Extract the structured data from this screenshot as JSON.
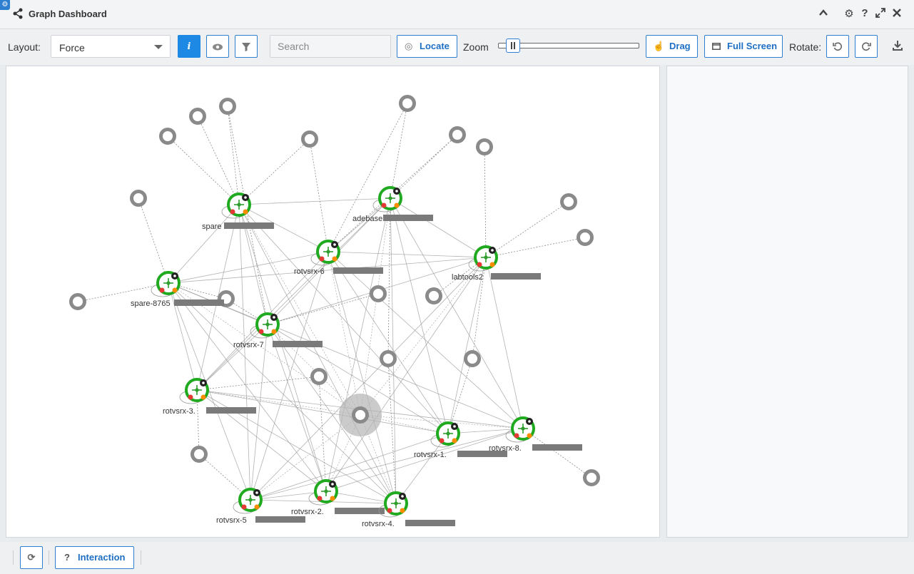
{
  "window": {
    "title": "Graph Dashboard"
  },
  "toolbar": {
    "layout_label": "Layout:",
    "layout_value": "Force",
    "search_placeholder": "Search",
    "locate_label": "Locate",
    "zoom_label": "Zoom",
    "zoom_level": 0.06,
    "drag_label": "Drag",
    "fullscreen_label": "Full Screen",
    "rotate_label": "Rotate:"
  },
  "footer": {
    "interaction_label": "Interaction"
  },
  "colors": {
    "accent": "#1e88e5",
    "node_ring": "#1faa1f",
    "edge": "#999999",
    "endpoint": "#8a8a8a"
  },
  "graph": {
    "devices": [
      {
        "id": "spare",
        "label": "spare"
      },
      {
        "id": "adebase",
        "label": "adebase"
      },
      {
        "id": "rotvsrx-6",
        "label": "rotvsrx-6"
      },
      {
        "id": "labtools2",
        "label": "labtools2"
      },
      {
        "id": "spare-8765",
        "label": "spare-8765"
      },
      {
        "id": "rotvsrx-7",
        "label": "rotvsrx-7"
      },
      {
        "id": "rotvsrx-3",
        "label": "rotvsrx-3."
      },
      {
        "id": "rotvsrx-1",
        "label": "rotvsrx-1."
      },
      {
        "id": "rotvsrx-8",
        "label": "rotvsrx-8."
      },
      {
        "id": "rotvsrx-5",
        "label": "rotvsrx-5"
      },
      {
        "id": "rotvsrx-2",
        "label": "rotvsrx-2."
      },
      {
        "id": "rotvsrx-4",
        "label": "rotvsrx-4."
      }
    ],
    "endpoints": 20
  }
}
